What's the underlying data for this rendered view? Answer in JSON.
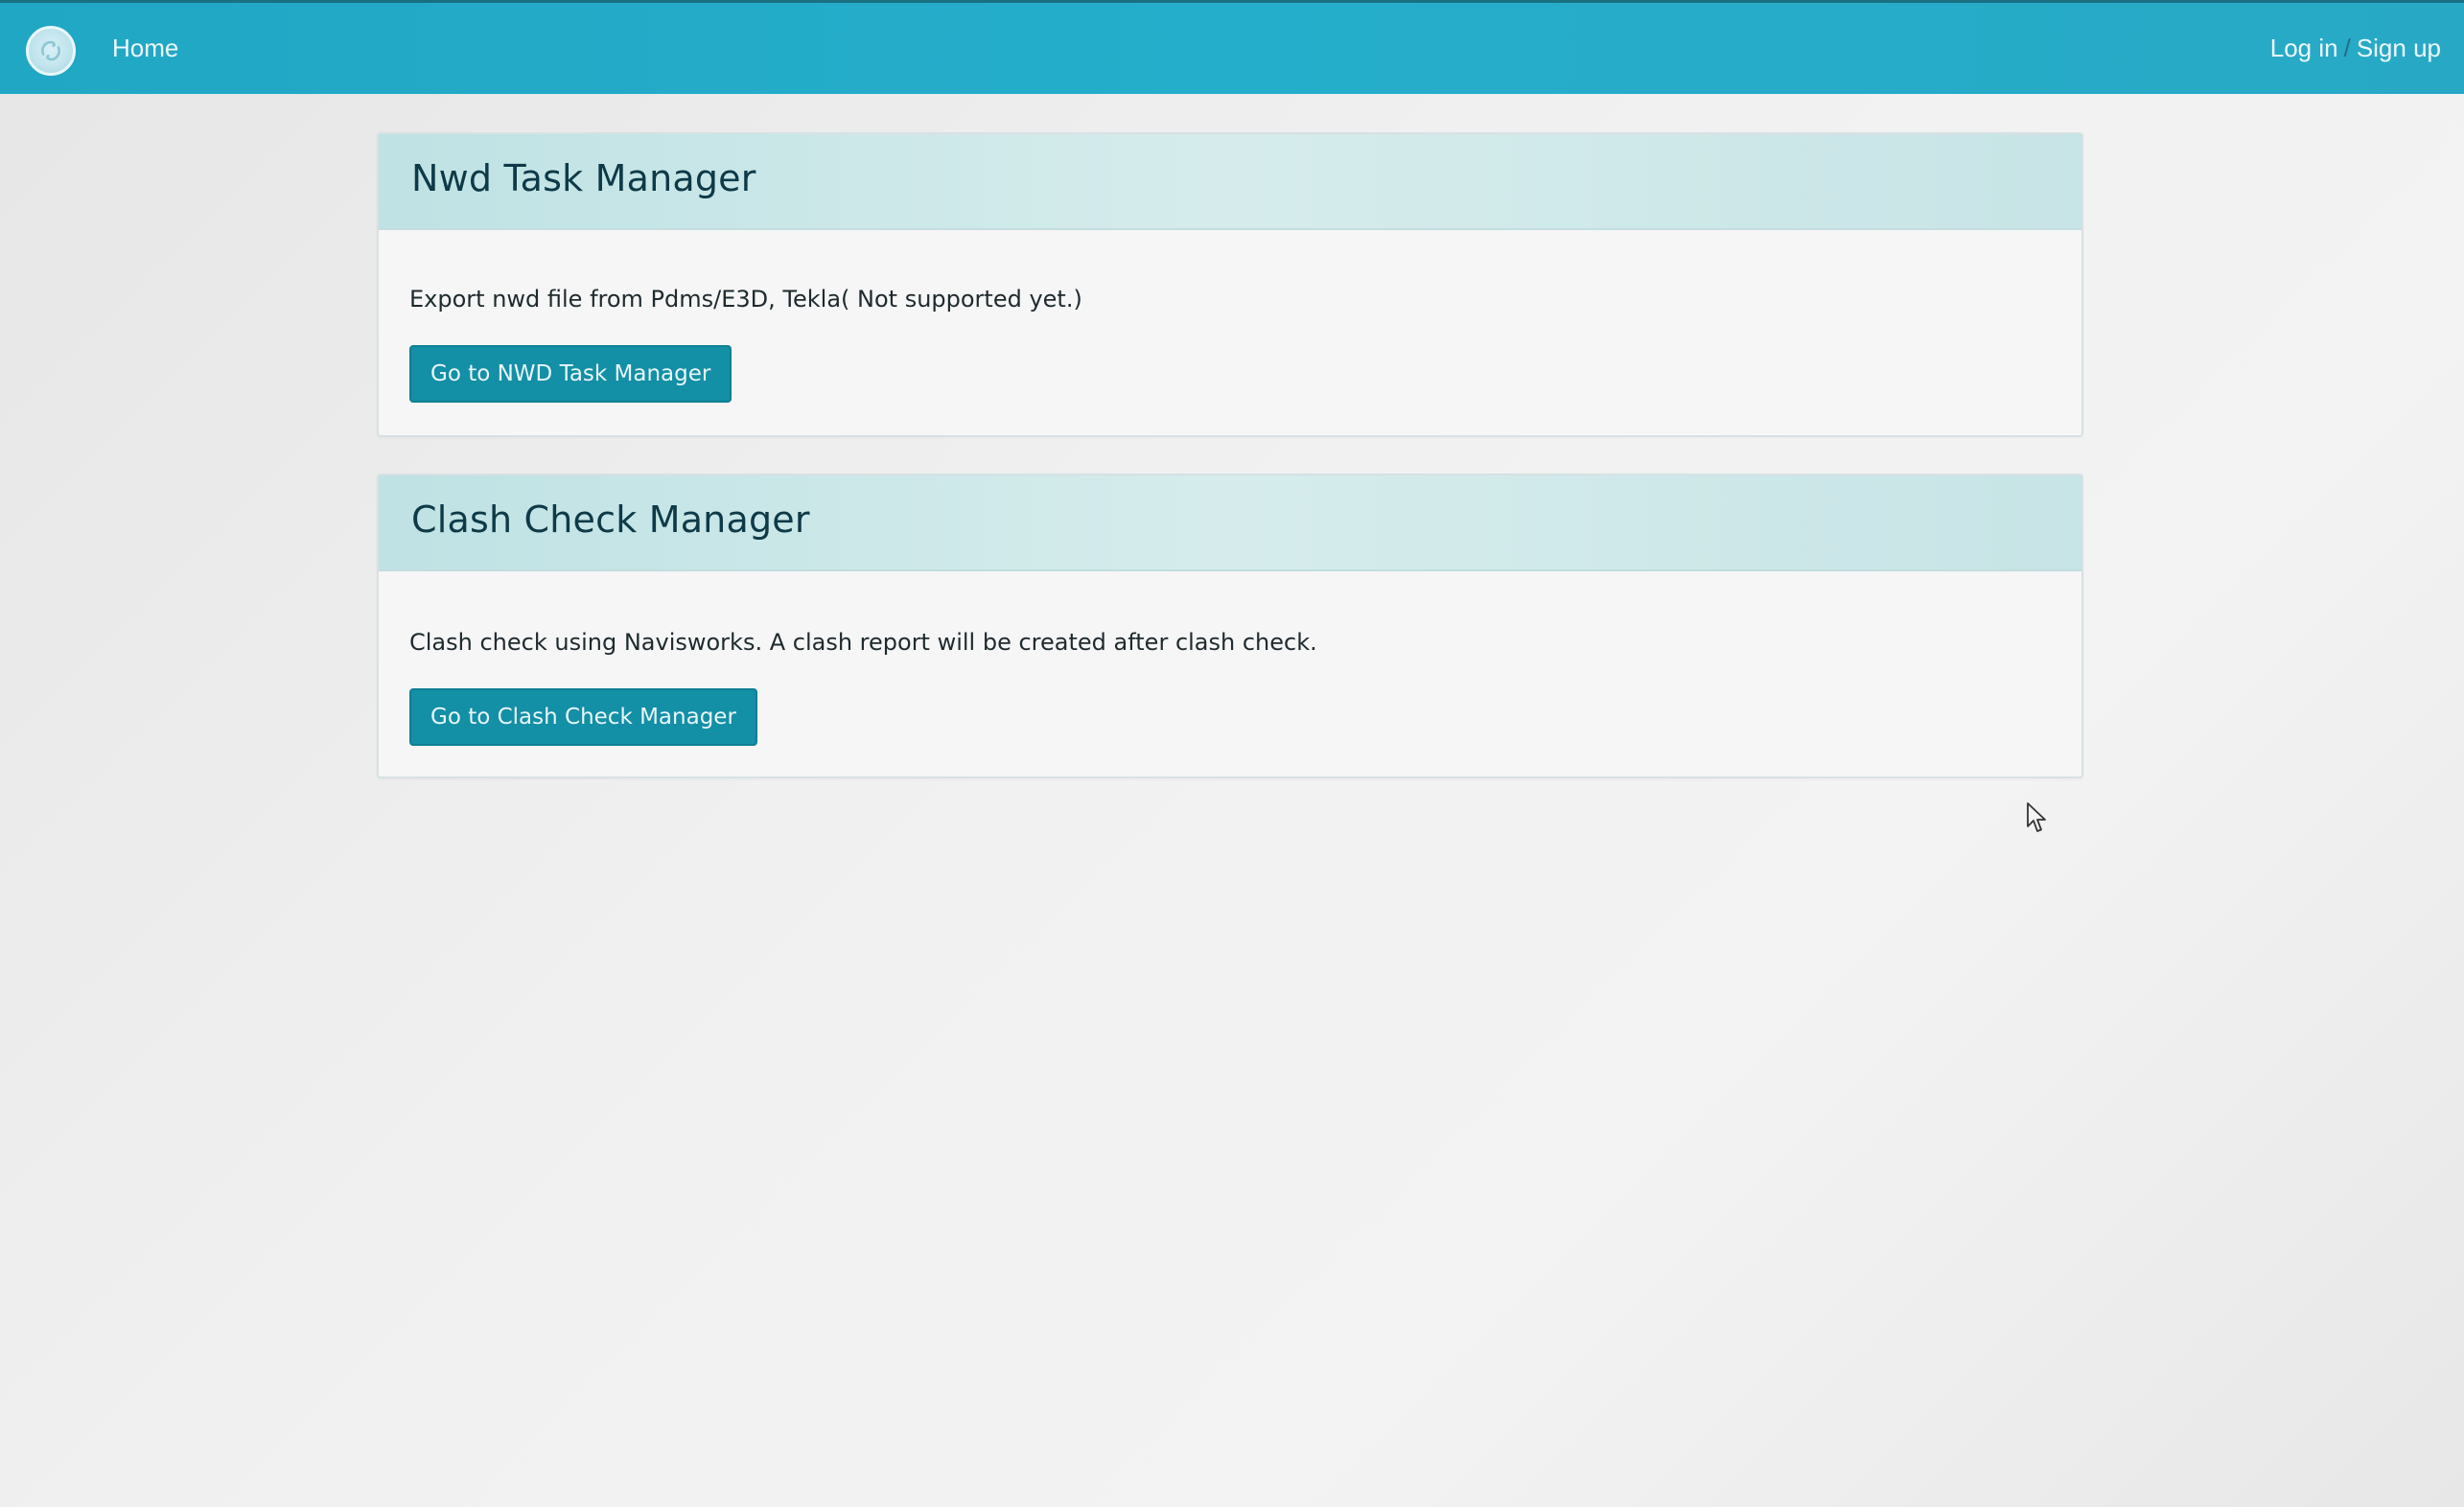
{
  "navbar": {
    "logo_icon": "ge-logo-icon",
    "home_label": "Home",
    "login_label": "Log in",
    "separator": "/",
    "signup_label": "Sign up",
    "bg_color": "#25aecb"
  },
  "panels": [
    {
      "title": "Nwd Task Manager",
      "description": "Export nwd file from Pdms/E3D, Tekla( Not supported yet.)",
      "button_label": "Go to NWD Task Manager"
    },
    {
      "title": "Clash Check Manager",
      "description": "Clash check using Navisworks. A clash report will be created after clash check.",
      "button_label": "Go to Clash Check Manager"
    }
  ],
  "colors": {
    "panel_heading": "#cde8e9",
    "button": "#138fa6",
    "title_text": "#0e3a48"
  },
  "cursor_icon": "mouse-pointer-icon"
}
